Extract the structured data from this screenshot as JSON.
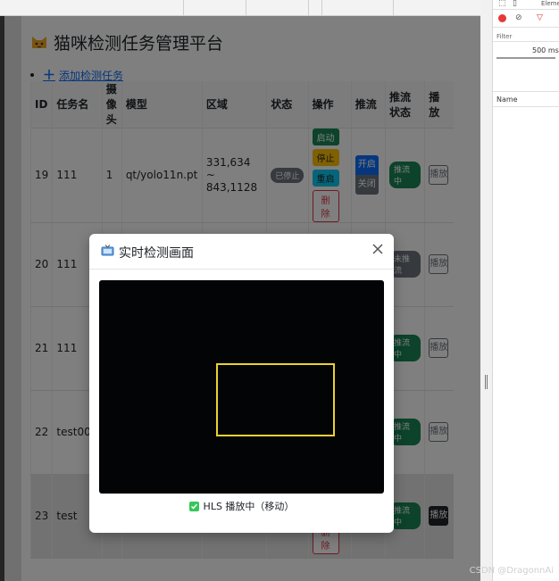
{
  "app": {
    "title": "猫咪检测任务管理平台",
    "add_task_label": "添加检测任务"
  },
  "table": {
    "headers": {
      "id": "ID",
      "name": "任务名",
      "camera": "摄像头",
      "model": "模型",
      "region": "区域",
      "status": "状态",
      "ops": "操作",
      "push": "推流",
      "push_status": "推流状态",
      "play": "播放"
    },
    "rows": [
      {
        "id": "19",
        "name": "111",
        "camera": "1",
        "model": "qt/yolo11n.pt",
        "region": "331,634 ~ 843,1128",
        "status": "已停止",
        "push_status": "推流中",
        "play": "播放"
      },
      {
        "id": "20",
        "name": "111",
        "push_status": "未推流",
        "play": "播放"
      },
      {
        "id": "21",
        "name": "111",
        "push_status": "推流中",
        "play": "播放"
      },
      {
        "id": "22",
        "name": "test001",
        "push_status": "推流中",
        "play": "播放"
      },
      {
        "id": "23",
        "name": "test",
        "push_status": "推流中",
        "play": "播放"
      }
    ],
    "op_labels": {
      "start": "启动",
      "stop": "停止",
      "restart": "重启",
      "delete": "删除"
    },
    "push_labels": {
      "on": "开启",
      "off": "关闭"
    }
  },
  "modal": {
    "title": "实时检测画面",
    "status": "HLS 播放中（移动）"
  },
  "devtools": {
    "tab_label": "Eleme",
    "filter_label": "Filter",
    "throttle_label": "500 ms",
    "column_name": "Name"
  },
  "watermark": "CSDN @DragonnAi",
  "colors": {
    "detection_box": "#e8d234",
    "primary": "#0d6efd",
    "success": "#198754"
  }
}
